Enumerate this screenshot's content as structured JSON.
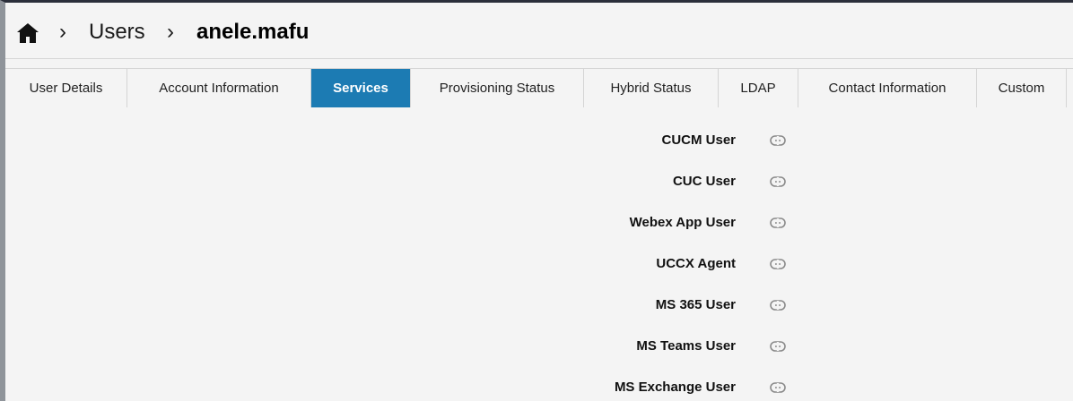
{
  "breadcrumb": {
    "home_icon": "home-icon",
    "separator_icon": "chevron-right-icon",
    "separator_glyph": "›",
    "users": "Users",
    "current": "anele.mafu"
  },
  "tabs": [
    {
      "label": "User Details",
      "active": false
    },
    {
      "label": "Account Information",
      "active": false
    },
    {
      "label": "Services",
      "active": true
    },
    {
      "label": "Provisioning Status",
      "active": false
    },
    {
      "label": "Hybrid Status",
      "active": false
    },
    {
      "label": "LDAP",
      "active": false
    },
    {
      "label": "Contact Information",
      "active": false
    },
    {
      "label": "Custom",
      "active": false
    }
  ],
  "services": [
    {
      "label": "CUCM User",
      "icon": "link-icon"
    },
    {
      "label": "CUC User",
      "icon": "link-icon"
    },
    {
      "label": "Webex App User",
      "icon": "link-icon"
    },
    {
      "label": "UCCX Agent",
      "icon": "link-icon"
    },
    {
      "label": "MS 365 User",
      "icon": "link-icon"
    },
    {
      "label": "MS Teams User",
      "icon": "link-icon"
    },
    {
      "label": "MS Exchange User",
      "icon": "link-icon"
    }
  ],
  "colors": {
    "accent": "#1c7bb3",
    "background": "#f4f4f4",
    "text": "#111111",
    "icon": "#8a8a8a"
  }
}
